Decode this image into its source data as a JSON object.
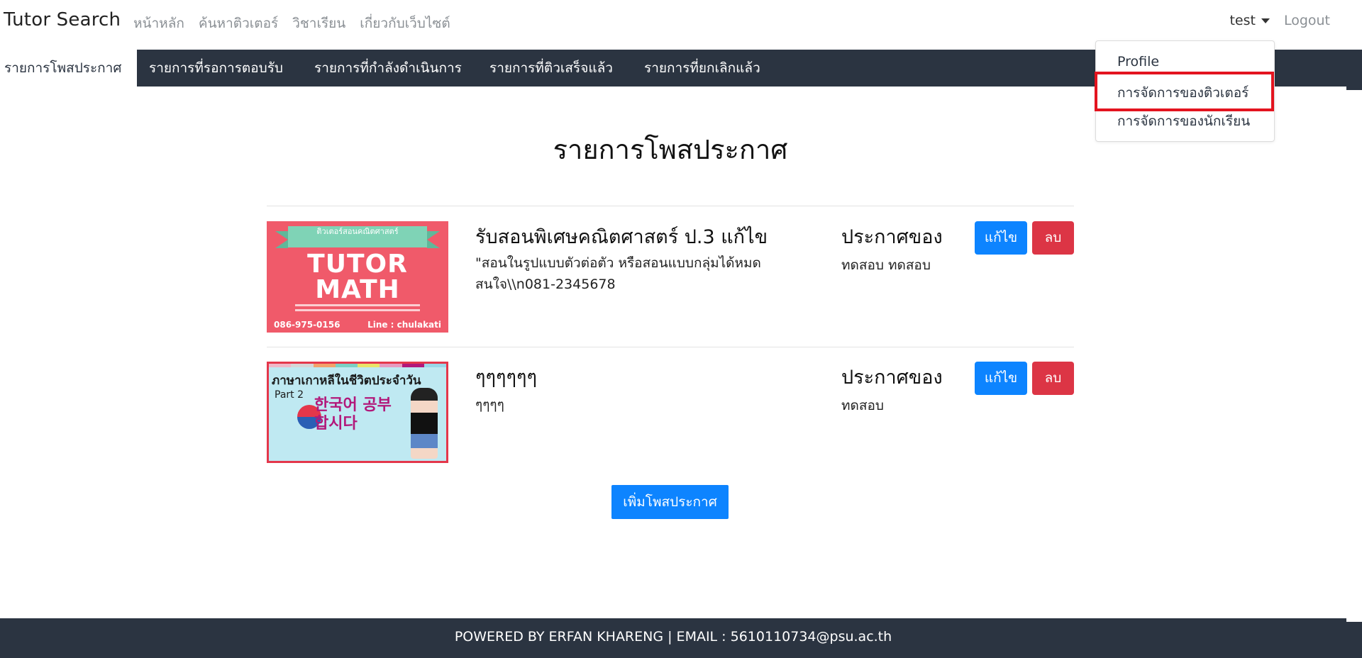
{
  "header": {
    "brand": "Tutor Search",
    "nav": [
      "หน้าหลัก",
      "ค้นหาติวเตอร์",
      "วิชาเรียน",
      "เกี่ยวกับเว็บไซต์"
    ],
    "user": "test",
    "logout": "Logout"
  },
  "dropdown": {
    "items": [
      "Profile",
      "การจัดการของติวเตอร์",
      "การจัดการของนักเรียน"
    ],
    "highlighted_item": "การจัดการของติวเตอร์"
  },
  "subnav": {
    "tabs": [
      "รายการโพสประกาศ",
      "รายการที่รอการตอบรับ",
      "รายการที่กำลังดำเนินการ",
      "รายการที่ติวเสร็จแล้ว",
      "รายการที่ยกเลิกแล้ว"
    ],
    "active_tab": "รายการโพสประกาศ"
  },
  "main": {
    "title": "รายการโพสประกาศ",
    "posts": [
      {
        "title": "รับสอนพิเศษคณิตศาสตร์ ป.3 แก้ไข",
        "description": "\"สอนในรูปแบบตัวต่อตัว หรือสอนแบบกลุ่มได้หมด สนใจ\\\\n081-2345678",
        "owner_label": "ประกาศของ",
        "owner_name": "ทดสอบ ทดสอบ",
        "image": {
          "banner": "ติวเตอร์สอนคณิตศาสตร์",
          "line1": "TUTOR",
          "line2": "MATH",
          "phone": "086-975-0156",
          "line_id": "Line : chulakati"
        }
      },
      {
        "title": "ๆๆๆๆๆๆ",
        "description": "ๆๆๆๆ",
        "owner_label": "ประกาศของ",
        "owner_name": "ทดสอบ",
        "image": {
          "title": "ภาษาเกาหลีในชีวิตประจำวัน",
          "part": "Part 2",
          "korean": "한국어 공부합시다"
        }
      }
    ],
    "edit_label": "แก้ไข",
    "delete_label": "ลบ",
    "add_label": "เพิ่มโพสประกาศ"
  },
  "footer": {
    "text": "POWERED BY ERFAN KHARENG | EMAIL : 5610110734@psu.ac.th"
  },
  "colors": {
    "dark_nav": "#2b3441",
    "primary": "#0d84ff",
    "danger": "#dc3545",
    "highlight": "#e3141f"
  }
}
